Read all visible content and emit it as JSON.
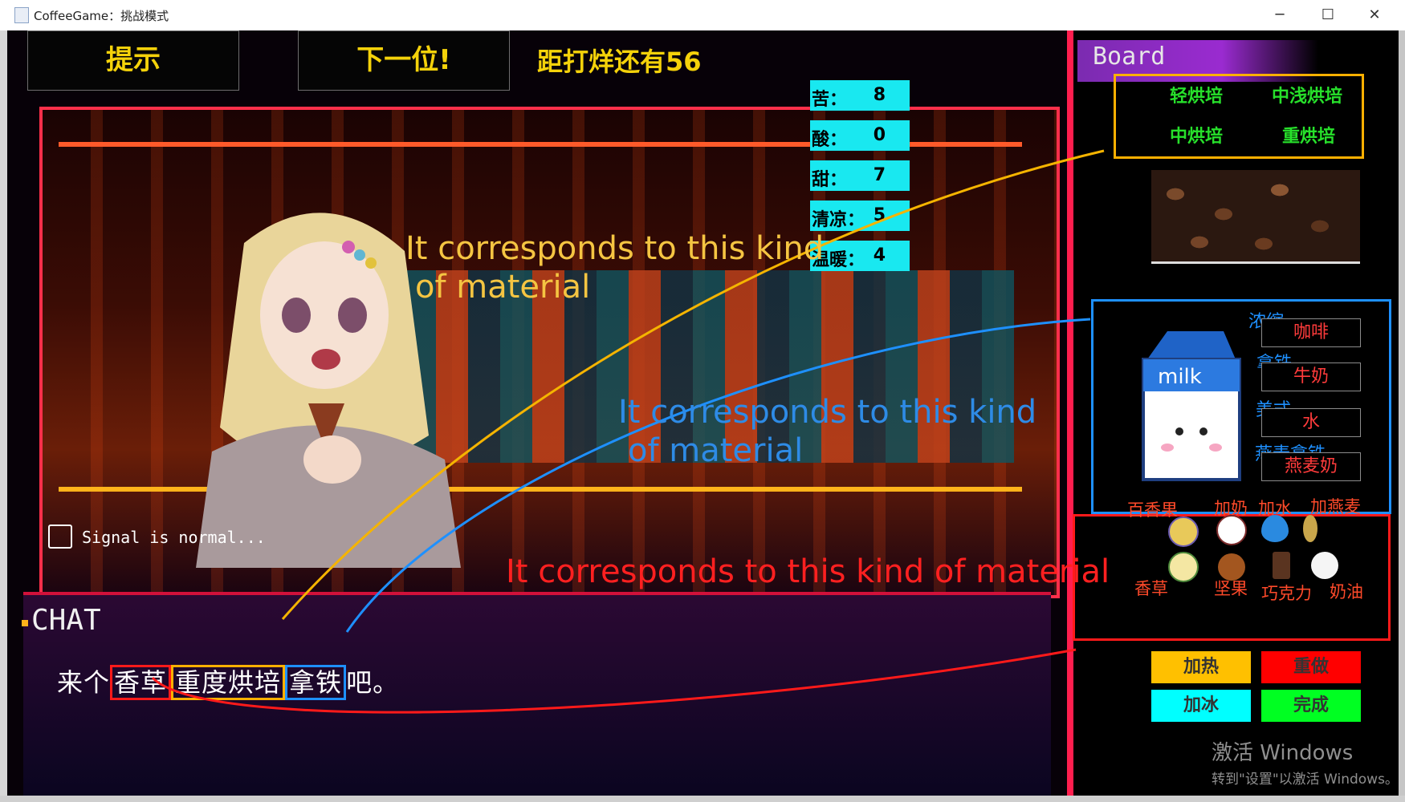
{
  "window": {
    "title": "CoffeeGame：挑战模式",
    "minimize": "─",
    "maximize": "☐",
    "close": "✕"
  },
  "top_bar": {
    "hint_label": "提示",
    "next_label": "下一位!",
    "countdown": "距打烊还有56"
  },
  "scene": {
    "signal_text": "Signal is normal..."
  },
  "stats": [
    {
      "label": "苦：",
      "value": "8"
    },
    {
      "label": "酸：",
      "value": "0"
    },
    {
      "label": "甜：",
      "value": "7"
    },
    {
      "label": "清凉：",
      "value": "5"
    },
    {
      "label": "温暖：",
      "value": "4"
    }
  ],
  "chat": {
    "label": "CHAT",
    "order_prefix": "来个",
    "order_flavor": "香草",
    "order_roast": "重度烘培",
    "order_base": "拿铁",
    "order_suffix": "吧。"
  },
  "board": {
    "title": "Board",
    "roasts": [
      "轻烘培",
      "中浅烘培",
      "中烘培",
      "重烘培"
    ],
    "bases": [
      {
        "label": "浓缩",
        "field": "咖啡"
      },
      {
        "label": "拿铁",
        "field": "牛奶"
      },
      {
        "label": "美式",
        "field": "水"
      },
      {
        "label": "燕麦拿铁",
        "field": "燕麦奶"
      }
    ],
    "add_ins_top": [
      "百香果",
      "加奶",
      "加水",
      "加燕麦"
    ],
    "add_ins_bottom": [
      "香草",
      "坚果",
      "巧克力",
      "奶油"
    ],
    "actions": {
      "heat": "加热",
      "redo": "重做",
      "ice": "加冰",
      "done": "完成"
    }
  },
  "annotations": {
    "yellow_line1": "It corresponds to this kind",
    "yellow_line2": "of material",
    "blue_line1": "It corresponds to this kind",
    "blue_line2": "of material",
    "red": "It corresponds to this kind of material"
  },
  "watermark": {
    "line1": "激活 Windows",
    "line2": "转到\"设置\"以激活 Windows。"
  },
  "colors": {
    "roast_box": "#ffb000",
    "base_box": "#1e90ff",
    "addin_box": "#ff1a1a",
    "stat_bg": "#19e8f0"
  }
}
